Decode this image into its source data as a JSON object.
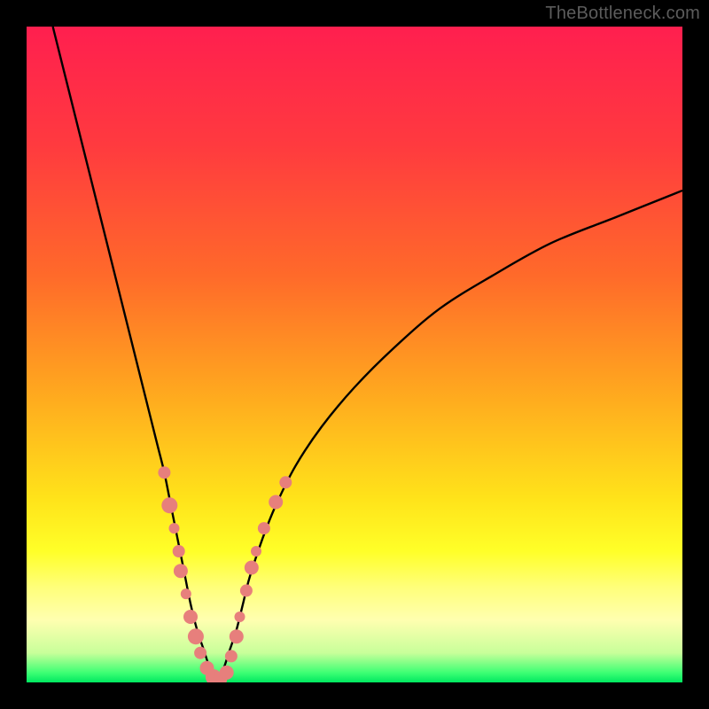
{
  "watermark": "TheBottleneck.com",
  "colors": {
    "frame": "#000000",
    "gradient_stops": [
      {
        "offset": 0.0,
        "color": "#ff1f4f"
      },
      {
        "offset": 0.18,
        "color": "#ff3a3f"
      },
      {
        "offset": 0.38,
        "color": "#ff6a2a"
      },
      {
        "offset": 0.55,
        "color": "#ffa51f"
      },
      {
        "offset": 0.72,
        "color": "#ffe31a"
      },
      {
        "offset": 0.8,
        "color": "#ffff28"
      },
      {
        "offset": 0.855,
        "color": "#ffff7a"
      },
      {
        "offset": 0.905,
        "color": "#ffffb0"
      },
      {
        "offset": 0.955,
        "color": "#c8ff9a"
      },
      {
        "offset": 0.985,
        "color": "#3eff74"
      },
      {
        "offset": 1.0,
        "color": "#00e860"
      }
    ],
    "curve": "#000000",
    "dot_fill": "#e77f7c",
    "dot_stroke": "#c85a57"
  },
  "chart_data": {
    "type": "line",
    "title": "",
    "xlabel": "",
    "ylabel": "",
    "xlim": [
      0,
      100
    ],
    "ylim": [
      0,
      100
    ],
    "series": [
      {
        "name": "left-branch",
        "x": [
          4,
          6,
          8,
          10,
          12,
          14,
          16,
          18,
          19,
          20,
          21,
          22,
          23,
          24,
          25,
          26,
          27,
          28,
          29
        ],
        "y": [
          100,
          92,
          84,
          76,
          68,
          60,
          52,
          44,
          40,
          36,
          32,
          27,
          22,
          17,
          12,
          8,
          5,
          2,
          0
        ]
      },
      {
        "name": "right-branch",
        "x": [
          29,
          30,
          31,
          32,
          33,
          34,
          36,
          38,
          41,
          45,
          50,
          56,
          63,
          71,
          80,
          90,
          100
        ],
        "y": [
          0,
          2,
          5,
          8,
          12,
          16,
          22,
          27,
          33,
          39,
          45,
          51,
          57,
          62,
          67,
          71,
          75
        ]
      }
    ],
    "scatter": {
      "name": "highlight-dots",
      "points": [
        {
          "x": 21.0,
          "y": 32.0,
          "r": 7
        },
        {
          "x": 21.8,
          "y": 27.0,
          "r": 9
        },
        {
          "x": 22.5,
          "y": 23.5,
          "r": 6
        },
        {
          "x": 23.2,
          "y": 20.0,
          "r": 7
        },
        {
          "x": 23.5,
          "y": 17.0,
          "r": 8
        },
        {
          "x": 24.3,
          "y": 13.5,
          "r": 6
        },
        {
          "x": 25.0,
          "y": 10.0,
          "r": 8
        },
        {
          "x": 25.8,
          "y": 7.0,
          "r": 9
        },
        {
          "x": 26.5,
          "y": 4.5,
          "r": 7
        },
        {
          "x": 27.5,
          "y": 2.2,
          "r": 8
        },
        {
          "x": 28.5,
          "y": 0.8,
          "r": 9
        },
        {
          "x": 29.5,
          "y": 0.5,
          "r": 8
        },
        {
          "x": 30.5,
          "y": 1.5,
          "r": 8
        },
        {
          "x": 31.2,
          "y": 4.0,
          "r": 7
        },
        {
          "x": 32.0,
          "y": 7.0,
          "r": 8
        },
        {
          "x": 32.5,
          "y": 10.0,
          "r": 6
        },
        {
          "x": 33.5,
          "y": 14.0,
          "r": 7
        },
        {
          "x": 34.3,
          "y": 17.5,
          "r": 8
        },
        {
          "x": 35.0,
          "y": 20.0,
          "r": 6
        },
        {
          "x": 36.2,
          "y": 23.5,
          "r": 7
        },
        {
          "x": 38.0,
          "y": 27.5,
          "r": 8
        },
        {
          "x": 39.5,
          "y": 30.5,
          "r": 7
        }
      ]
    }
  }
}
